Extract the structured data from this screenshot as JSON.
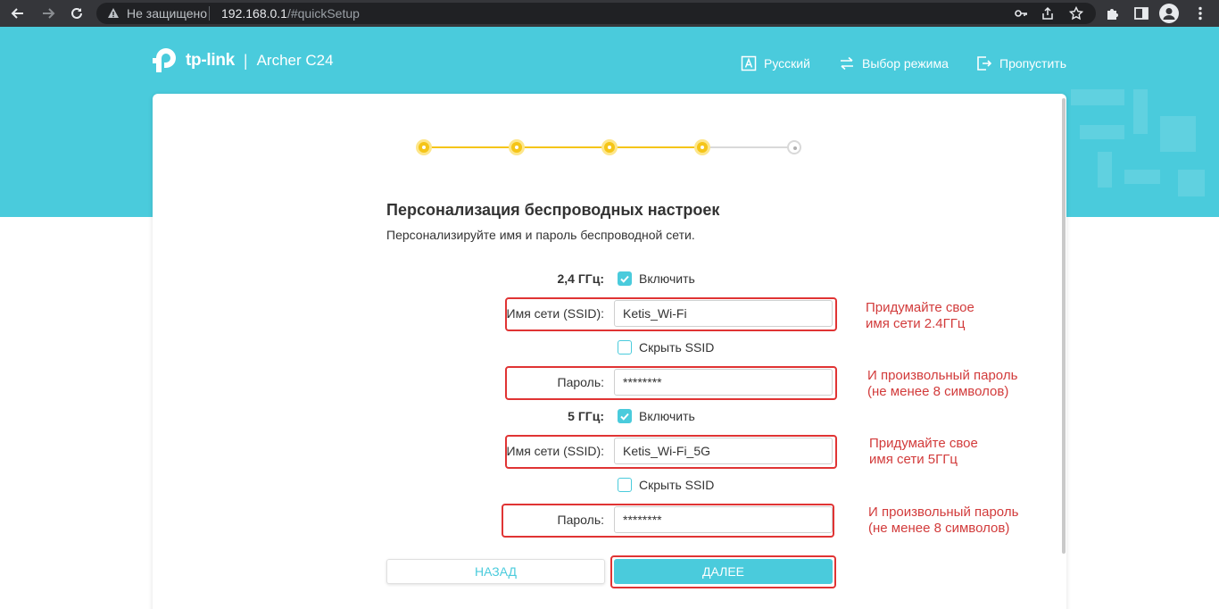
{
  "browser": {
    "security_label": "Не защищено",
    "url_host": "192.168.0.1",
    "url_path": "/#quickSetup"
  },
  "header": {
    "logo_text": "tp-link",
    "separator": "|",
    "model": "Archer C24",
    "nav": {
      "language": "Русский",
      "mode": "Выбор режима",
      "skip": "Пропустить"
    }
  },
  "wizard": {
    "steps": [
      {
        "state": "done"
      },
      {
        "state": "done"
      },
      {
        "state": "done"
      },
      {
        "state": "done"
      },
      {
        "state": "current"
      }
    ],
    "title": "Персонализация беспроводных настроек",
    "subtitle": "Персонализируйте имя и пароль беспроводной сети.",
    "band24": {
      "label": "2,4 ГГц:",
      "enable_label": "Включить",
      "enabled": true,
      "ssid_label": "Имя сети (SSID):",
      "ssid_value": "Ketis_Wi-Fi",
      "hide_ssid_label": "Скрыть SSID",
      "hide_ssid": false,
      "password_label": "Пароль:",
      "password_value": "********"
    },
    "band5": {
      "label": "5 ГГц:",
      "enable_label": "Включить",
      "enabled": true,
      "ssid_label": "Имя сети (SSID):",
      "ssid_value": "Ketis_Wi-Fi_5G",
      "hide_ssid_label": "Скрыть SSID",
      "hide_ssid": false,
      "password_label": "Пароль:",
      "password_value": "********"
    },
    "back_label": "НАЗАД",
    "next_label": "ДАЛЕЕ"
  },
  "annotations": {
    "ssid24": [
      "Придумайте свое",
      "имя сети 2.4ГГц"
    ],
    "pass24": [
      "И произвольный пароль",
      "(не менее 8 символов)"
    ],
    "ssid5": [
      "Придумайте свое",
      "имя сети 5ГГц"
    ],
    "pass5": [
      "И произвольный пароль",
      "(не менее 8 символов)"
    ]
  },
  "colors": {
    "brand_teal": "#4acbdc",
    "step_active": "#f5c518",
    "annotation_red": "#e03434"
  }
}
